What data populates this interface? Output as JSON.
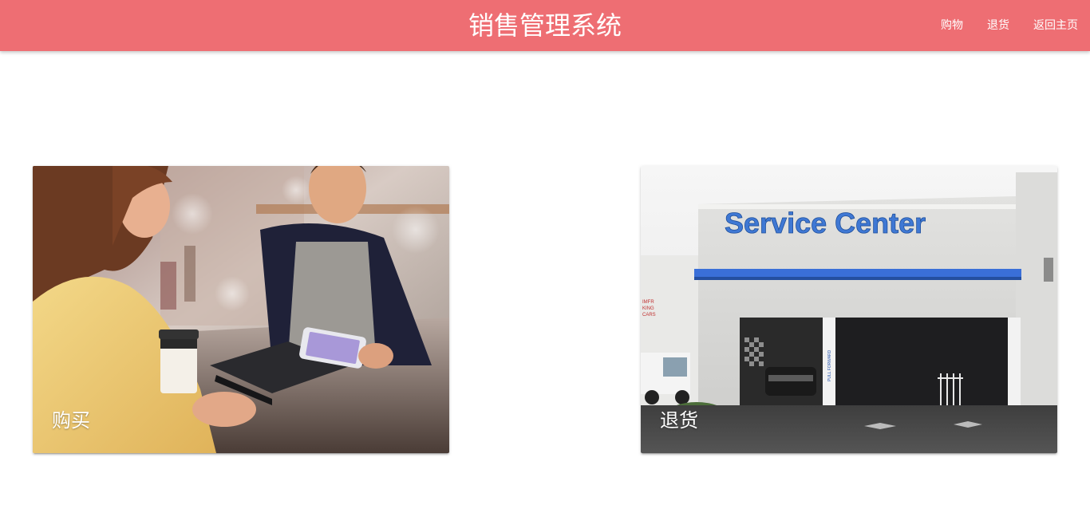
{
  "header": {
    "title": "销售管理系统",
    "nav": [
      "购物",
      "退货",
      "返回主页"
    ],
    "color": "#ee6e73"
  },
  "cards": [
    {
      "label": "购买",
      "image": "cashier-payment-photo"
    },
    {
      "label": "退货",
      "image": "service-center-photo",
      "sign_text": "Service Center",
      "pillar_text": "PULL FORWARD"
    }
  ]
}
